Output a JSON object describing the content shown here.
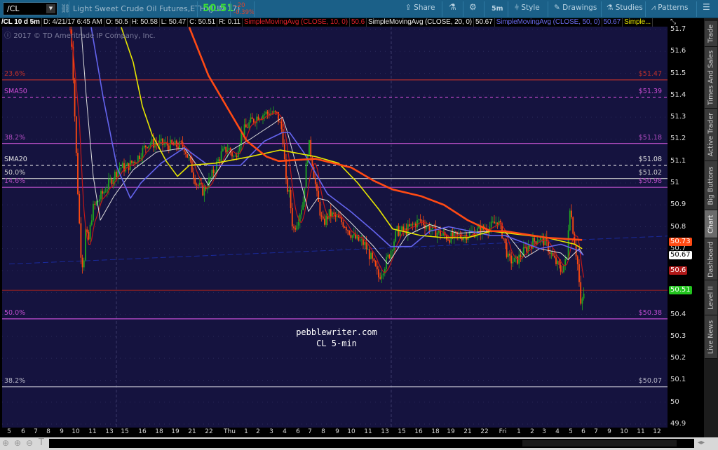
{
  "header": {
    "symbol": "/CL",
    "description": "Light Sweet Crude Oil Futures,ETH (JUN 17)",
    "last": "50.51",
    "change": "-.20",
    "change_pct": "-0.39%",
    "toolbar": {
      "share": "Share",
      "interval": "5m",
      "style": "Style",
      "drawings": "Drawings",
      "studies": "Studies",
      "patterns": "Patterns"
    }
  },
  "legend": {
    "symbol_period": "/CL 10 d 5m",
    "date": "D: 4/21/17 6:45 AM",
    "open": "O: 50.5",
    "high": "H: 50.58",
    "low": "L: 50.47",
    "close": "C: 50.51",
    "range": "R: 0.11",
    "studies": [
      {
        "label": "SimpleMovingAvg (CLOSE, 10, 0)",
        "value": "50.6",
        "color": "#e0202a"
      },
      {
        "label": "SimpleMovingAvg (CLOSE, 20, 0)",
        "value": "50.67",
        "color": "#e8e8e8"
      },
      {
        "label": "SimpleMovingAvg (CLOSE, 50, 0)",
        "value": "50.67",
        "color": "#6a6af0"
      },
      {
        "label": "Simple...",
        "value": "",
        "color": "#e6e600"
      }
    ]
  },
  "copyright": "2017 © TD Ameritrade IP Company, Inc.",
  "watermark": {
    "line1": "pebblewriter.com",
    "line2": "CL 5-min"
  },
  "side_tabs": [
    "Trade",
    "Times And Sales",
    "Active Trader",
    "Big Buttons",
    "Chart",
    "Dashboard",
    "Level II",
    "Live News"
  ],
  "active_tab": "Chart",
  "chart_data": {
    "type": "candlestick",
    "ylim": [
      49.9,
      51.7
    ],
    "yticks": [
      "51.7",
      "51.6",
      "51.5",
      "51.4",
      "51.3",
      "51.2",
      "51.1",
      "51",
      "50.9",
      "50.8",
      "50.7",
      "50.6",
      "50.5",
      "50.4",
      "50.3",
      "50.2",
      "50.1",
      "50",
      "49.9"
    ],
    "xticks": [
      "5",
      "6",
      "7",
      "8",
      "9",
      "10",
      "11",
      "13",
      "15",
      "16",
      "18",
      "19",
      "21",
      "22",
      "Thu",
      "1",
      "2",
      "3",
      "4",
      "6",
      "7",
      "8",
      "9",
      "10",
      "11",
      "13",
      "15",
      "16",
      "18",
      "19",
      "21",
      "22",
      "Fri",
      "1",
      "2",
      "3",
      "4",
      "5",
      "6",
      "7",
      "9",
      "10",
      "11",
      "12"
    ],
    "x_note": "x values are positions along xticks (index)",
    "close": [
      [
        4.6,
        51.7
      ],
      [
        4.75,
        51.61
      ],
      [
        5.0,
        51.19
      ],
      [
        5.17,
        50.88
      ],
      [
        5.33,
        50.65
      ],
      [
        5.46,
        50.62
      ],
      [
        5.58,
        50.78
      ],
      [
        5.75,
        50.73
      ],
      [
        6.0,
        50.88
      ],
      [
        6.33,
        50.92
      ],
      [
        6.75,
        50.97
      ],
      [
        7.18,
        51.02
      ],
      [
        7.64,
        51.07
      ],
      [
        8.08,
        51.07
      ],
      [
        8.68,
        51.11
      ],
      [
        9.29,
        51.18
      ],
      [
        9.92,
        51.18
      ],
      [
        10.78,
        51.17
      ],
      [
        11.5,
        51.17
      ],
      [
        11.83,
        51.1
      ],
      [
        12.25,
        51.0
      ],
      [
        12.67,
        50.96
      ],
      [
        13.07,
        51.02
      ],
      [
        13.59,
        51.13
      ],
      [
        13.93,
        51.16
      ],
      [
        14.33,
        51.11
      ],
      [
        14.75,
        51.23
      ],
      [
        15.24,
        51.27
      ],
      [
        16.1,
        51.31
      ],
      [
        16.9,
        51.32
      ],
      [
        17.42,
        51.31
      ],
      [
        17.84,
        51.23
      ],
      [
        18.1,
        51.0
      ],
      [
        18.37,
        50.94
      ],
      [
        18.63,
        50.78
      ],
      [
        19.0,
        50.84
      ],
      [
        19.41,
        50.91
      ],
      [
        19.88,
        51.19
      ],
      [
        20.16,
        51.1
      ],
      [
        20.53,
        50.94
      ],
      [
        20.95,
        50.81
      ],
      [
        21.45,
        50.86
      ],
      [
        21.95,
        50.84
      ],
      [
        22.55,
        50.81
      ],
      [
        23.17,
        50.75
      ],
      [
        23.79,
        50.72
      ],
      [
        24.21,
        50.65
      ],
      [
        24.63,
        50.57
      ],
      [
        24.96,
        50.62
      ],
      [
        25.29,
        50.68
      ],
      [
        25.71,
        50.78
      ],
      [
        26.21,
        50.78
      ],
      [
        26.71,
        50.81
      ],
      [
        27.13,
        50.83
      ],
      [
        27.54,
        50.8
      ],
      [
        27.96,
        50.78
      ],
      [
        28.86,
        50.75
      ],
      [
        29.71,
        50.76
      ],
      [
        30.54,
        50.78
      ],
      [
        31.35,
        50.8
      ],
      [
        31.73,
        50.83
      ],
      [
        32.04,
        50.75
      ],
      [
        32.35,
        50.65
      ],
      [
        32.78,
        50.64
      ],
      [
        33.26,
        50.68
      ],
      [
        33.84,
        50.72
      ],
      [
        34.53,
        50.75
      ],
      [
        35.1,
        50.73
      ],
      [
        35.74,
        50.65
      ],
      [
        36.26,
        50.6
      ],
      [
        36.7,
        50.65
      ],
      [
        36.91,
        50.91
      ],
      [
        37.06,
        50.84
      ],
      [
        37.33,
        50.72
      ],
      [
        37.61,
        50.6
      ],
      [
        37.78,
        50.43
      ],
      [
        38.0,
        50.49
      ],
      [
        38.1,
        50.51
      ]
    ],
    "series": [
      {
        "name": "SimpleMovingAvg (CLOSE, 20, 0)",
        "color": "#dcdcdc",
        "points": [
          [
            5.3,
            51.72
          ],
          [
            5.63,
            51.39
          ],
          [
            6.04,
            51.03
          ],
          [
            6.46,
            50.83
          ],
          [
            7.3,
            50.94
          ],
          [
            8.48,
            51.06
          ],
          [
            9.83,
            51.14
          ],
          [
            11.54,
            51.16
          ],
          [
            12.38,
            51.07
          ],
          [
            12.96,
            50.99
          ],
          [
            14.13,
            51.15
          ],
          [
            15.35,
            51.2
          ],
          [
            17.16,
            51.27
          ],
          [
            17.84,
            51.3
          ],
          [
            18.21,
            51.23
          ],
          [
            19.88,
            50.87
          ],
          [
            20.58,
            50.93
          ],
          [
            21.3,
            50.92
          ],
          [
            22.95,
            50.82
          ],
          [
            24.33,
            50.71
          ],
          [
            25.17,
            50.63
          ],
          [
            26.29,
            50.76
          ],
          [
            27.67,
            50.81
          ],
          [
            29.42,
            50.77
          ],
          [
            31.35,
            50.78
          ],
          [
            32.13,
            50.78
          ],
          [
            33.5,
            50.66
          ],
          [
            34.63,
            50.7
          ],
          [
            36.26,
            50.68
          ],
          [
            36.8,
            50.65
          ],
          [
            37.67,
            50.7
          ],
          [
            38.0,
            50.67
          ]
        ]
      },
      {
        "name": "SimpleMovingAvg (CLOSE, 50, 0)",
        "color": "#6464ee",
        "points": [
          [
            5.92,
            51.71
          ],
          [
            6.63,
            51.39
          ],
          [
            7.5,
            51.07
          ],
          [
            8.32,
            50.93
          ],
          [
            8.92,
            51.0
          ],
          [
            10.12,
            51.09
          ],
          [
            11.54,
            51.16
          ],
          [
            12.96,
            51.08
          ],
          [
            14.13,
            51.08
          ],
          [
            14.67,
            51.08
          ],
          [
            16.47,
            51.19
          ],
          [
            17.84,
            51.23
          ],
          [
            18.37,
            51.23
          ],
          [
            19.47,
            51.14
          ],
          [
            21.3,
            50.95
          ],
          [
            22.95,
            50.87
          ],
          [
            24.33,
            50.78
          ],
          [
            25.33,
            50.71
          ],
          [
            26.58,
            50.71
          ],
          [
            27.67,
            50.78
          ],
          [
            28.86,
            50.8
          ],
          [
            31.35,
            50.76
          ],
          [
            32.13,
            50.76
          ],
          [
            34.63,
            50.7
          ],
          [
            36.26,
            50.72
          ],
          [
            37.67,
            50.69
          ],
          [
            38.0,
            50.67
          ]
        ]
      },
      {
        "name": "Simple...",
        "color": "#e6e600",
        "points": [
          [
            7.77,
            51.71
          ],
          [
            8.48,
            51.55
          ],
          [
            9.0,
            51.35
          ],
          [
            9.58,
            51.22
          ],
          [
            10.43,
            51.1
          ],
          [
            11.13,
            51.03
          ],
          [
            11.83,
            51.08
          ],
          [
            13.31,
            51.09
          ],
          [
            15.35,
            51.12
          ],
          [
            17.68,
            51.15
          ],
          [
            20.42,
            51.12
          ],
          [
            22.1,
            51.09
          ],
          [
            23.38,
            51.0
          ],
          [
            24.63,
            50.88
          ],
          [
            25.46,
            50.79
          ],
          [
            27.13,
            50.76
          ],
          [
            28.55,
            50.75
          ],
          [
            30.0,
            50.75
          ],
          [
            31.35,
            50.78
          ],
          [
            35.2,
            50.75
          ],
          [
            37.33,
            50.72
          ],
          [
            37.9,
            50.7
          ]
        ]
      },
      {
        "color": "#ff4a14",
        "value_label": "50.73",
        "points": [
          [
            11.83,
            51.71
          ],
          [
            12.97,
            51.49
          ],
          [
            13.86,
            51.35
          ],
          [
            15.08,
            51.19
          ],
          [
            16.63,
            51.12
          ],
          [
            17.53,
            51.1
          ],
          [
            17.68,
            51.1
          ],
          [
            20.42,
            51.11
          ],
          [
            23.0,
            51.07
          ],
          [
            24.33,
            51.01
          ],
          [
            25.46,
            50.97
          ],
          [
            27.13,
            50.94
          ],
          [
            28.55,
            50.9
          ],
          [
            30.0,
            50.83
          ],
          [
            31.35,
            50.78
          ],
          [
            32.13,
            50.78
          ],
          [
            35.2,
            50.75
          ],
          [
            37.9,
            50.74
          ]
        ]
      }
    ],
    "levels": [
      {
        "label": "23.6%",
        "price_label": "$51.47",
        "value": 51.47,
        "color": "#c0302a",
        "style": "solid"
      },
      {
        "label": "SMA50",
        "price_label": "$51.39",
        "value": 51.39,
        "color": "#d24ed8",
        "style": "dashed"
      },
      {
        "label": "38.2%",
        "price_label": "$51.18",
        "value": 51.18,
        "color": "#b04cc0",
        "style": "solid"
      },
      {
        "label": "SMA20",
        "price_label": "$51.08",
        "value": 51.08,
        "color": "#e6e6e6",
        "style": "dashed"
      },
      {
        "label": "50.0%",
        "price_label": "$51.02",
        "value": 51.02,
        "color": "#cfcfcf",
        "style": "solid"
      },
      {
        "label": "14.6%",
        "price_label": "$50.98",
        "value": 50.98,
        "color": "#b04cc0",
        "style": "solid"
      },
      {
        "label": "",
        "price_label": "",
        "value": 50.51,
        "color": "#8e2020",
        "style": "solid"
      },
      {
        "label": "50.0%",
        "price_label": "$50.38",
        "value": 50.38,
        "color": "#c04cd0",
        "style": "solid"
      },
      {
        "label": "38.2%",
        "price_label": "$50.07",
        "value": 50.07,
        "color": "#b8b8c8",
        "style": "solid"
      }
    ],
    "trendline": {
      "from": [
        0,
        50.63
      ],
      "to": [
        44.5,
        50.76
      ],
      "color": "#1a2a9a"
    },
    "price_badges": [
      {
        "value": "50.73",
        "color": "#ff4a14",
        "text": "#fff",
        "price": 50.73
      },
      {
        "value": "50.67",
        "color": "#ffffff",
        "text": "#000",
        "price": 50.67
      },
      {
        "value": "50.6",
        "color": "#b01818",
        "text": "#fff",
        "price": 50.6
      },
      {
        "value": "50.51",
        "color": "#22c41e",
        "text": "#fff",
        "price": 50.51
      }
    ]
  }
}
